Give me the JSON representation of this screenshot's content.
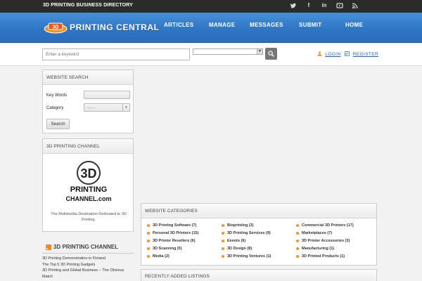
{
  "topbar": {
    "tagline": "3D PRINTING BUSINESS DIRECTORY",
    "social_icons": [
      "twitter-icon",
      "facebook-icon",
      "linkedin-icon",
      "youtube-icon",
      "rss-icon"
    ]
  },
  "header": {
    "logo_text": "PRINTING CENTRAL",
    "nav": [
      "ARTICLES",
      "MANAGE",
      "MESSAGES",
      "SUBMIT",
      "HOME"
    ],
    "colors": {
      "header_blue": "#2f76c6",
      "accent_orange": "#f39322"
    }
  },
  "search": {
    "keyword_placeholder": "Enter a keyword",
    "login": "LOGIN",
    "register": "REGISTER"
  },
  "website_search": {
    "title": "WEBSITE SEARCH",
    "keywords_label": "Key Words",
    "category_label": "Category",
    "category_value": "-------",
    "button": "Search"
  },
  "channel": {
    "title": "3D PRINTING CHANNEL",
    "logo_lines": [
      "3D",
      "PRINTING",
      "CHANNEL.com"
    ],
    "description": "The Multimedia Destination Dedicated to 3D Printing."
  },
  "rss": {
    "title": "3D PRINTING CHANNEL",
    "items": [
      "3D Printing Demonstration in Finland",
      "The Top 5 3D Printing Gadgets",
      "3D Printing and Global Business – The Obvious Match"
    ]
  },
  "categories": {
    "title": "WEBSITE CATEGORIES",
    "columns": [
      [
        "3D Printing Software (7)",
        "Personal 3D Printers (15)",
        "3D Printer Resellers (6)",
        "3D Scanning (5)",
        "Media (2)"
      ],
      [
        "Bioprinting (3)",
        "3D Printing Services (9)",
        "Events (6)",
        "3D Design (8)",
        "3D Printing Ventures (1)"
      ],
      [
        "Commercial 3D Printers (17)",
        "Marketplaces (7)",
        "3D Printer Accessories (3)",
        "Manufacturing (1)",
        "3D Printed Products (1)"
      ]
    ]
  },
  "recent": {
    "title": "RECENTLY ADDED LISTINGS"
  }
}
